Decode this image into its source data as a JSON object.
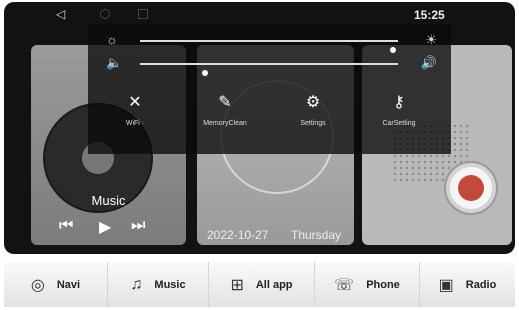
{
  "status": {
    "time": "15:25",
    "back_icon": "back-triangle-icon"
  },
  "quick_panel": {
    "brightness_level": 0.98,
    "volume_level": 0.25,
    "toggles": [
      {
        "label": "WiFi ·",
        "icon": "wifi-off-icon"
      },
      {
        "label": "MemoryClean",
        "icon": "broom-icon"
      },
      {
        "label": "Settings",
        "icon": "gear-icon"
      },
      {
        "label": "CarSetting",
        "icon": "car-key-icon"
      }
    ]
  },
  "music_card": {
    "title": "Music"
  },
  "clock_card": {
    "date": "2022-10-27",
    "weekday": "Thursday"
  },
  "dock": {
    "items": [
      {
        "label": "Navi",
        "icon": "navigation-icon"
      },
      {
        "label": "Music",
        "icon": "music-note-icon"
      },
      {
        "label": "All app",
        "icon": "grid-icon"
      },
      {
        "label": "Phone",
        "icon": "phone-icon"
      },
      {
        "label": "Radio",
        "icon": "radio-icon"
      }
    ]
  }
}
